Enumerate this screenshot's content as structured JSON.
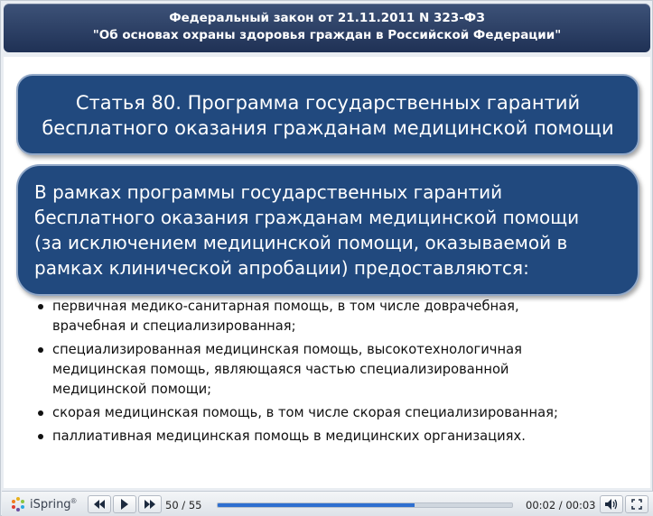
{
  "header": {
    "line1": "Федеральный закон от 21.11.2011 N 323-ФЗ",
    "line2": "\"Об основах охраны здоровья граждан в Российской Федерации\""
  },
  "slide": {
    "title_line1": "Статья 80. Программа государственных гарантий",
    "title_line2": "бесплатного оказания гражданам медицинской помощи",
    "intro_lines": [
      "В рамках программы государственных гарантий",
      "бесплатного оказания гражданам медицинской помощи",
      "(за исключением медицинской помощи, оказываемой в",
      "рамках клинической апробации) предоставляются:"
    ],
    "bullets": [
      [
        "первичная медико-санитарная помощь, в том числе доврачебная,",
        "врачебная и специализированная;"
      ],
      [
        "специализированная медицинская помощь, высокотехнологичная",
        "медицинская помощь, являющаяся частью специализированной",
        "медицинской помощи;"
      ],
      [
        "скорая медицинская помощь, в том числе скорая специализированная;"
      ],
      [
        "паллиативная медицинская помощь в медицинских организациях."
      ]
    ]
  },
  "player": {
    "logo_text": "iSpring",
    "logo_mark": "®",
    "slide_counter": "50 / 55",
    "progress_fraction": 0.67,
    "time": "00:02 / 00:03",
    "icons": {
      "prev": "previous-slide-icon",
      "play": "play-icon",
      "next": "next-slide-icon",
      "volume": "volume-icon",
      "fullscreen": "fullscreen-icon"
    }
  },
  "colors": {
    "header_bg": "#2a3d63",
    "box_bg": "#21497e",
    "box_border": "#93a9c8",
    "progress": "#2e6fd0"
  }
}
